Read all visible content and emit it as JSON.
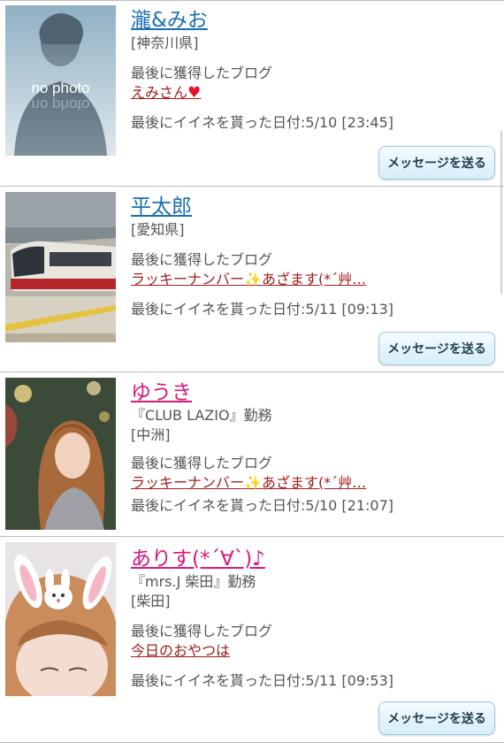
{
  "users": [
    {
      "name": "瀧&みお",
      "gender": "male",
      "workplace": "",
      "area": "[神奈川県]",
      "blog_label": "最後に獲得したブログ",
      "blog_title": "えみさん",
      "blog_emoji": "♥",
      "liked_date": "最後にイイネを貰った日付:5/10 [23:45]",
      "message_button": "メッセージを送る",
      "photo": "no-photo-silhouette",
      "photo_text": "no photo"
    },
    {
      "name": "平太郎",
      "gender": "male",
      "workplace": "",
      "area": "[愛知県]",
      "blog_label": "最後に獲得したブログ",
      "blog_title": "ラッキーナンバー",
      "blog_emoji": "✨",
      "blog_title_rest": "あざます(*´艸…",
      "liked_date": "最後にイイネを貰った日付:5/11 [09:13]",
      "message_button": "メッセージを送る",
      "photo": "train-photo"
    },
    {
      "name": "ゆうき",
      "gender": "female",
      "workplace": "『CLUB LAZIO』勤務",
      "area": "[中洲]",
      "blog_label": "最後に獲得したブログ",
      "blog_title": "ラッキーナンバー",
      "blog_emoji": "✨",
      "blog_title_rest": "あざます(*´艸…",
      "liked_date": "最後にイイネを貰った日付:5/10 [21:07]",
      "message_button": "",
      "photo": "woman-portrait-photo"
    },
    {
      "name": "ありす(*´∀`)♪",
      "gender": "female",
      "workplace": "『mrs.J 柴田』勤務",
      "area": "[柴田]",
      "blog_label": "最後に獲得したブログ",
      "blog_title": "今日のおやつは",
      "liked_date": "最後にイイネを貰った日付:5/11 [09:53]",
      "message_button": "メッセージを送る",
      "photo": "bunny-filter-selfie-photo"
    }
  ],
  "colors": {
    "male_name": "#1a6fb3",
    "female_name": "#d9197a",
    "blog_link": "#a21c1c",
    "button_border": "#9fc9dd"
  }
}
